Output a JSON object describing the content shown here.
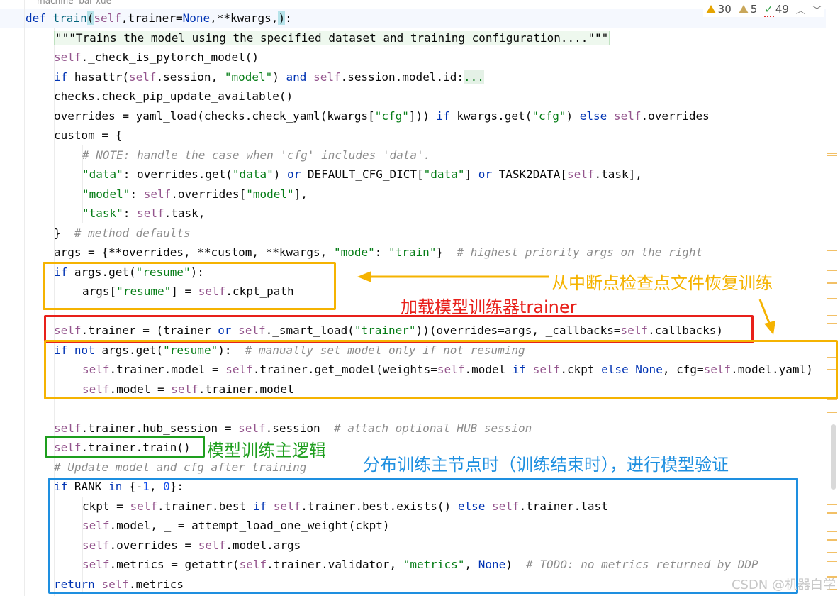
{
  "editor": {
    "usage_hint": "machine  bar xue",
    "inspections": {
      "warnings": "30",
      "weak_warnings": "5",
      "typos": "49"
    },
    "code_lines": [
      [
        [
          "kw",
          "def "
        ],
        [
          "fn",
          "train"
        ],
        [
          "hl",
          "("
        ],
        [
          "self",
          "self"
        ],
        [
          "",
          ","
        ],
        [
          "",
          "trainer="
        ],
        [
          "kw",
          "None"
        ],
        [
          "",
          ",**kwargs,"
        ],
        [
          "hl",
          ")"
        ],
        [
          "",
          ":"
        ]
      ],
      [
        [
          "doc",
          "\"\"\"Trains the model using the specified dataset and training configuration....\"\"\""
        ]
      ],
      [
        [
          "self",
          "self"
        ],
        [
          "",
          "._check_is_pytorch_model()"
        ]
      ],
      [
        [
          "kw",
          "if "
        ],
        [
          "",
          "hasattr("
        ],
        [
          "self",
          "self"
        ],
        [
          "",
          ".session, "
        ],
        [
          "str",
          "\"model\""
        ],
        [
          "",
          ") "
        ],
        [
          "kw",
          "and "
        ],
        [
          "self",
          "self"
        ],
        [
          "",
          ".session.model.id:"
        ],
        [
          "fold",
          "..."
        ]
      ],
      [
        [
          "",
          "checks.check_pip_update_available()"
        ]
      ],
      [
        [
          "",
          "overrides = yaml_load(checks.check_yaml(kwargs["
        ],
        [
          "str",
          "\"cfg\""
        ],
        [
          "",
          "])) "
        ],
        [
          "kw",
          "if "
        ],
        [
          "",
          "kwargs.get("
        ],
        [
          "str",
          "\"cfg\""
        ],
        [
          "",
          ") "
        ],
        [
          "kw",
          "else "
        ],
        [
          "self",
          "self"
        ],
        [
          "",
          ".overrides"
        ]
      ],
      [
        [
          "",
          "custom = {"
        ]
      ],
      [
        [
          "cmt",
          "# NOTE: handle the case when 'cfg' includes 'data'."
        ]
      ],
      [
        [
          "str",
          "\"data\""
        ],
        [
          "",
          ": overrides.get("
        ],
        [
          "str",
          "\"data\""
        ],
        [
          "",
          ") "
        ],
        [
          "kw",
          "or "
        ],
        [
          "",
          "DEFAULT_CFG_DICT["
        ],
        [
          "str",
          "\"data\""
        ],
        [
          "",
          "] "
        ],
        [
          "kw",
          "or "
        ],
        [
          "",
          "TASK2DATA["
        ],
        [
          "self",
          "self"
        ],
        [
          "",
          ".task],"
        ]
      ],
      [
        [
          "str",
          "\"model\""
        ],
        [
          "",
          ": "
        ],
        [
          "self",
          "self"
        ],
        [
          "",
          ".overrides["
        ],
        [
          "str",
          "\"model\""
        ],
        [
          "",
          "],"
        ]
      ],
      [
        [
          "str",
          "\"task\""
        ],
        [
          "",
          ": "
        ],
        [
          "self",
          "self"
        ],
        [
          "",
          ".task,"
        ]
      ],
      [
        [
          "",
          "}  "
        ],
        [
          "cmt",
          "# method defaults"
        ]
      ],
      [
        [
          "",
          "args = {**overrides, **custom, **kwargs, "
        ],
        [
          "str",
          "\"mode\""
        ],
        [
          "",
          ": "
        ],
        [
          "str",
          "\"train\""
        ],
        [
          "",
          "}  "
        ],
        [
          "cmt",
          "# highest priority args on the right"
        ]
      ],
      [
        [
          "kw",
          "if "
        ],
        [
          "",
          "args.get("
        ],
        [
          "str",
          "\"resume\""
        ],
        [
          "",
          "):"
        ]
      ],
      [
        [
          "",
          "args["
        ],
        [
          "str",
          "\"resume\""
        ],
        [
          "",
          "] = "
        ],
        [
          "self",
          "self"
        ],
        [
          "",
          ".ckpt_path"
        ]
      ],
      [],
      [
        [
          "self",
          "self"
        ],
        [
          "",
          ".trainer = (trainer "
        ],
        [
          "kw",
          "or "
        ],
        [
          "self",
          "self"
        ],
        [
          "",
          "._smart_load("
        ],
        [
          "str",
          "\"trainer\""
        ],
        [
          "",
          "))(overrides"
        ],
        [
          "",
          "=args, _callbacks="
        ],
        [
          "self",
          "self"
        ],
        [
          "",
          ".callbacks)"
        ]
      ],
      [
        [
          "kw",
          "if not "
        ],
        [
          "",
          "args.get("
        ],
        [
          "str",
          "\"resume\""
        ],
        [
          "",
          "):  "
        ],
        [
          "cmt",
          "# manually set model only if not resuming"
        ]
      ],
      [
        [
          "self",
          "self"
        ],
        [
          "",
          ".trainer.model = "
        ],
        [
          "self",
          "self"
        ],
        [
          "",
          ".trainer.get_model(weights="
        ],
        [
          "self",
          "self"
        ],
        [
          "",
          ".model "
        ],
        [
          "kw",
          "if "
        ],
        [
          "self",
          "self"
        ],
        [
          "",
          ".ckpt "
        ],
        [
          "kw",
          "else None"
        ],
        [
          "",
          ", cfg="
        ],
        [
          "self",
          "self"
        ],
        [
          "",
          ".model.yaml)"
        ]
      ],
      [
        [
          "self",
          "self"
        ],
        [
          "",
          ".model = "
        ],
        [
          "self",
          "self"
        ],
        [
          "",
          ".trainer.model"
        ]
      ],
      [],
      [
        [
          "self",
          "self"
        ],
        [
          "",
          ".trainer.hub_session = "
        ],
        [
          "self",
          "self"
        ],
        [
          "",
          ".session  "
        ],
        [
          "cmt",
          "# attach optional HUB session"
        ]
      ],
      [
        [
          "self",
          "self"
        ],
        [
          "",
          ".trainer.train()"
        ]
      ],
      [
        [
          "cmt",
          "# Update model and cfg after training"
        ]
      ],
      [
        [
          "kw",
          "if "
        ],
        [
          "",
          "RANK "
        ],
        [
          "kw",
          "in "
        ],
        [
          "",
          "{-"
        ],
        [
          "num",
          "1"
        ],
        [
          "",
          ", "
        ],
        [
          "num",
          "0"
        ],
        [
          "",
          "}:"
        ]
      ],
      [
        [
          "",
          "ckpt = "
        ],
        [
          "self",
          "self"
        ],
        [
          "",
          ".trainer.best "
        ],
        [
          "kw",
          "if "
        ],
        [
          "self",
          "self"
        ],
        [
          "",
          ".trainer.best.exists() "
        ],
        [
          "kw",
          "else "
        ],
        [
          "self",
          "self"
        ],
        [
          "",
          ".trainer.last"
        ]
      ],
      [
        [
          "self",
          "self"
        ],
        [
          "",
          ".model, _ = attempt_load_one_weight(ckpt)"
        ]
      ],
      [
        [
          "self",
          "self"
        ],
        [
          "",
          ".overrides = "
        ],
        [
          "self",
          "self"
        ],
        [
          "",
          ".model.args"
        ]
      ],
      [
        [
          "self",
          "self"
        ],
        [
          "",
          ".metrics = getattr("
        ],
        [
          "self",
          "self"
        ],
        [
          "",
          ".trainer.validator, "
        ],
        [
          "str",
          "\"metrics\""
        ],
        [
          "",
          ", "
        ],
        [
          "kw",
          "None"
        ],
        [
          "",
          ")  "
        ],
        [
          "cmt",
          "# TODO: no metrics returned by DDP"
        ]
      ],
      [
        [
          "kw",
          "return "
        ],
        [
          "self",
          "self"
        ],
        [
          "",
          ".metrics"
        ]
      ]
    ]
  },
  "annotations": {
    "resume_label": "从中断点检查点文件恢复训练",
    "trainer_label": "加载模型训练器trainer",
    "train_label": "模型训练主逻辑",
    "validate_label": "分布训练主节点时（训练结束时），进行模型验证",
    "colors": {
      "orange": "#f5b301",
      "red": "#e8201a",
      "green": "#1e9e1e",
      "blue": "#1e8fe0"
    }
  },
  "watermark": "CSDN @机器白学"
}
